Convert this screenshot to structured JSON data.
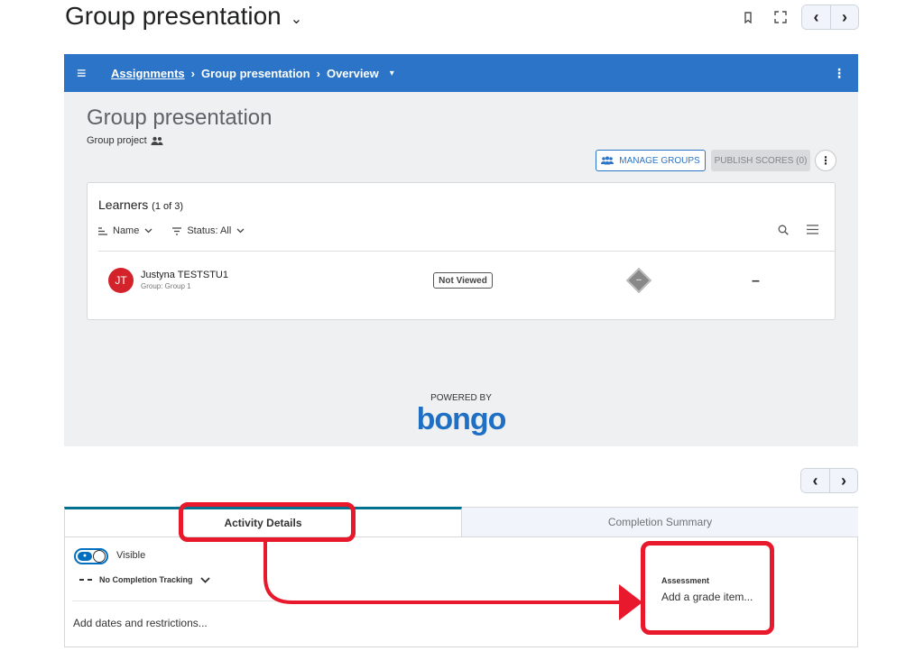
{
  "page": {
    "title": "Group presentation",
    "title_chevron": "⌄"
  },
  "top_tools": {
    "bookmark_icon": "bookmark-icon",
    "fullscreen_icon": "fullscreen-icon",
    "prev": "‹",
    "next": "›"
  },
  "lti": {
    "breadcrumb": {
      "link": "Assignments",
      "sep1": "›",
      "current": "Group presentation",
      "sep2": "›",
      "page": "Overview",
      "caret": "▾"
    },
    "menu_icon": "≡",
    "kebab": "⋮",
    "assignment_title": "Group presentation",
    "assignment_type": "Group project",
    "manage_groups": "MANAGE GROUPS",
    "publish_scores": "PUBLISH SCORES (0)",
    "more": "⋮",
    "learners": {
      "heading": "Learners",
      "count": "(1 of 3)",
      "sort": "Name",
      "filter": "Status: All",
      "rows": [
        {
          "initials": "JT",
          "name": "Justyna TESTSTU1",
          "group": "Group: Group 1",
          "status": "Not Viewed",
          "score": "–"
        }
      ]
    },
    "powered_by": "POWERED BY",
    "brand": "bongo",
    "colors": {
      "bar": "#2b74c7",
      "avatar": "#d3222a"
    }
  },
  "bottom": {
    "prev": "‹",
    "next": "›",
    "tabs": [
      {
        "label": "Activity Details"
      },
      {
        "label": "Completion Summary"
      }
    ],
    "visible_label": "Visible",
    "completion_tracking": "No Completion Tracking",
    "dates_link": "Add dates and restrictions...",
    "assessment_heading": "Assessment",
    "assessment_link": "Add a grade item..."
  }
}
